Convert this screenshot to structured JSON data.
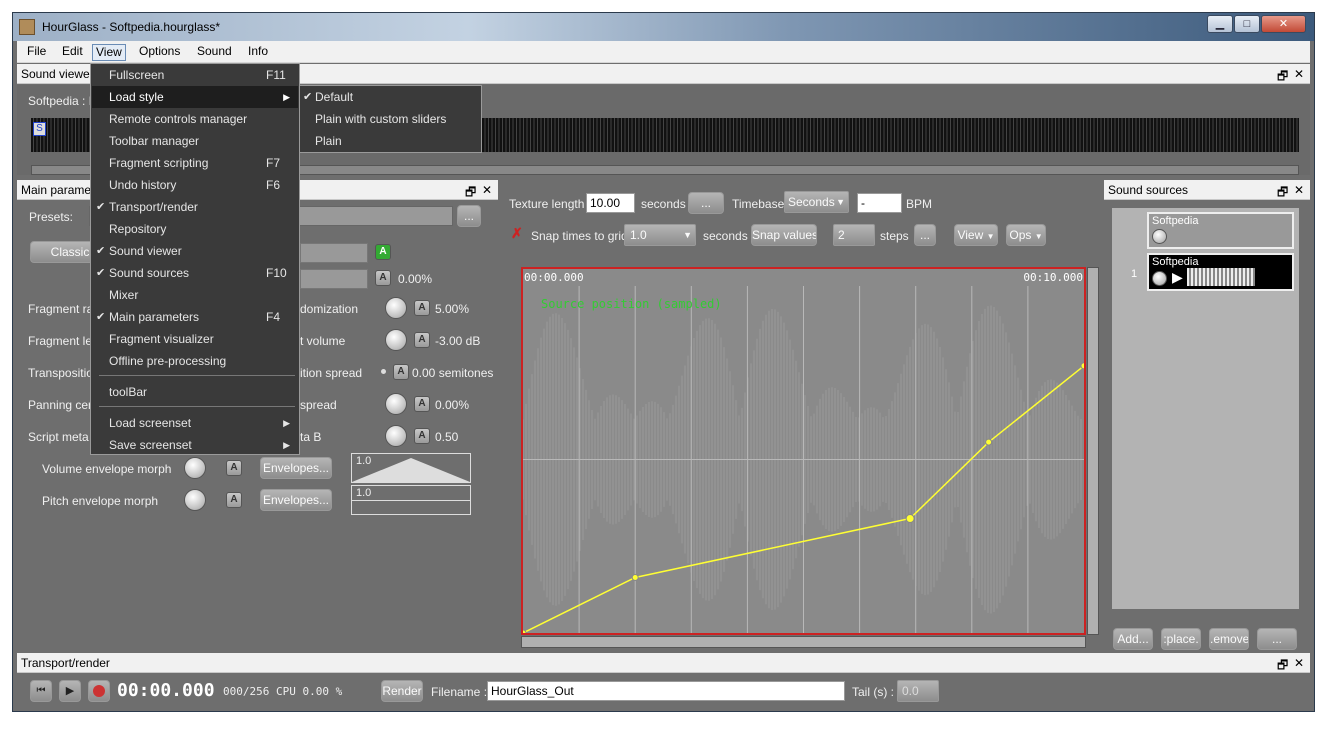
{
  "window": {
    "title": "HourGlass - Softpedia.hourglass*",
    "minimize": "▁",
    "maximize": "□",
    "close": "✕"
  },
  "menubar": [
    "File",
    "Edit",
    "View",
    "Options",
    "Sound",
    "Info"
  ],
  "view_menu": {
    "items": [
      {
        "label": "Fullscreen",
        "shortcut": "F11"
      },
      {
        "label": "Load style",
        "submenu": true
      },
      {
        "label": "Remote controls manager"
      },
      {
        "label": "Toolbar manager"
      },
      {
        "label": "Fragment scripting",
        "shortcut": "F7"
      },
      {
        "label": "Undo history",
        "shortcut": "F6"
      },
      {
        "label": "Transport/render",
        "checked": true
      },
      {
        "label": "Repository"
      },
      {
        "label": "Sound viewer",
        "checked": true
      },
      {
        "label": "Sound sources",
        "shortcut": "F10",
        "checked": true
      },
      {
        "label": "Mixer"
      },
      {
        "label": "Main parameters",
        "shortcut": "F4",
        "checked": true
      },
      {
        "label": "Fragment visualizer"
      },
      {
        "label": "Offline pre-processing"
      },
      {
        "label": "toolBar"
      },
      {
        "label": "Load screenset",
        "submenu": true
      },
      {
        "label": "Save screenset",
        "submenu": true
      }
    ],
    "load_style_submenu": [
      {
        "label": "Default",
        "checked": true
      },
      {
        "label": "Plain with custom sliders"
      },
      {
        "label": "Plain"
      }
    ]
  },
  "sound_viewer": {
    "title": "Sound viewer",
    "label": "Softpedia : L",
    "marker": "S"
  },
  "main_params": {
    "title": "Main paramet",
    "presets_label": "Presets:",
    "more_button": "...",
    "mode_button": "Classic",
    "a_green": "A",
    "top_value": "0.00%",
    "rows": [
      {
        "label": "Fragment rat",
        "param": "domization",
        "value": "5.00%"
      },
      {
        "label": "Fragment ler",
        "param": "t volume",
        "value": "-3.00 dB"
      },
      {
        "label": "Transpositio",
        "param": "ition spread",
        "value": "0.00 semitones"
      },
      {
        "label": "Panning cent",
        "param": "spread",
        "value": "0.00%"
      },
      {
        "label": "Script meta A",
        "param": "ta B",
        "value": "0.50"
      }
    ],
    "volume_env_label": "Volume envelope morph",
    "pitch_env_label": "Pitch envelope morph",
    "envelopes_button": "Envelopes...",
    "env_value_1": "1.0",
    "env_value_2": "1.0",
    "a_label": "A"
  },
  "texture": {
    "length_label": "Texture length",
    "length_value": "10.00",
    "seconds": "seconds",
    "dots": "...",
    "timebase_label": "Timebase",
    "timebase_value": "Seconds",
    "bpm_value": "-",
    "bpm_label": "BPM",
    "snap_label": "Snap times to grid",
    "snap_value": "1.0",
    "snap_unit": "seconds",
    "snap_values_btn": "Snap values",
    "steps_value": "2",
    "steps_label": "steps",
    "view_btn": "View",
    "ops_btn": "Ops",
    "time_start": "00:00.000",
    "time_end": "00:10.000",
    "plot_label": "Source position (sampled)"
  },
  "chart_data": {
    "type": "line",
    "x": [
      0,
      2.0,
      6.9,
      8.3,
      10
    ],
    "y": [
      0,
      0.16,
      0.33,
      0.55,
      0.77
    ],
    "xlim": [
      0,
      10
    ],
    "ylim": [
      0,
      1
    ],
    "grid": true
  },
  "sound_sources": {
    "title": "Sound sources",
    "items": [
      {
        "name": "Softpedia",
        "index": ""
      },
      {
        "name": "Softpedia",
        "index": "1"
      }
    ],
    "buttons": [
      "Add...",
      ":place.",
      ".emove",
      "..."
    ]
  },
  "transport": {
    "title": "Transport/render",
    "time": "00:00.000",
    "cpu": "000/256 CPU 0.00 %",
    "render_btn": "Render",
    "filename_label": "Filename :",
    "filename": "HourGlass_Out",
    "tail_label": "Tail (s) :",
    "tail_value": "0.0"
  },
  "colors": {
    "accent": "#ffff33",
    "plot_border": "#cc2222",
    "plot_label": "#33cc33"
  }
}
